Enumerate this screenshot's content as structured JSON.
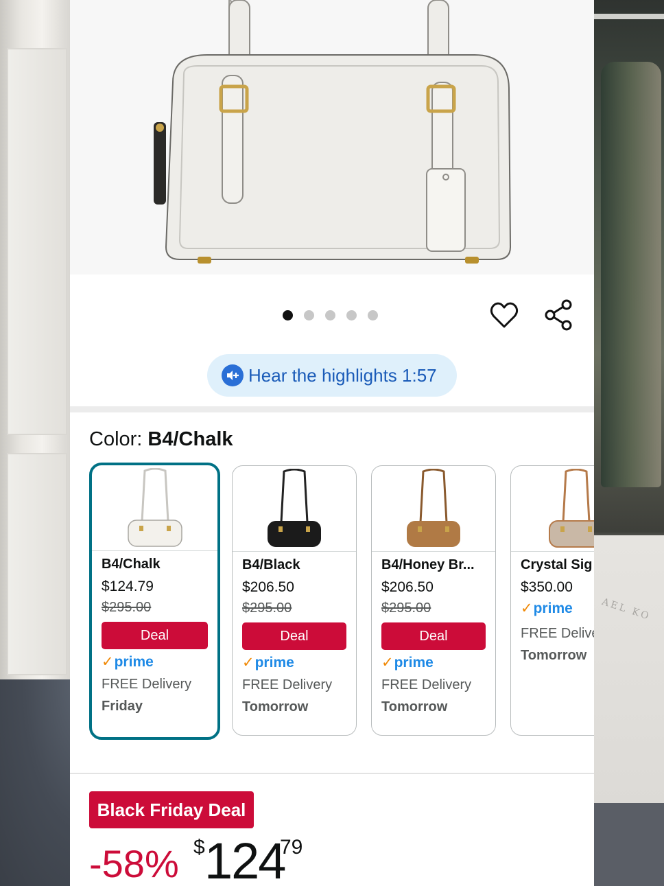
{
  "product": {
    "carousel": {
      "total_images": 5,
      "active_index": 0
    },
    "highlights_button_label": "Hear the highlights 1:57"
  },
  "color": {
    "label": "Color:",
    "selected": "B4/Chalk"
  },
  "swatches": [
    {
      "name": "B4/Chalk",
      "price": "$124.79",
      "list_price": "$295.00",
      "deal_label": "Deal",
      "prime_label": "prime",
      "delivery_label": "FREE Delivery",
      "delivery_day": "Friday",
      "bag_color": "#f3f1ec",
      "selected": true
    },
    {
      "name": "B4/Black",
      "price": "$206.50",
      "list_price": "$295.00",
      "deal_label": "Deal",
      "prime_label": "prime",
      "delivery_label": "FREE Delivery",
      "delivery_day": "Tomorrow",
      "bag_color": "#1b1b1b",
      "selected": false
    },
    {
      "name": "B4/Honey Br...",
      "price": "$206.50",
      "list_price": "$295.00",
      "deal_label": "Deal",
      "prime_label": "prime",
      "delivery_label": "FREE Delivery",
      "delivery_day": "Tomorrow",
      "bag_color": "#b07a45",
      "selected": false
    },
    {
      "name": "Crystal Sig",
      "price": "$350.00",
      "list_price": "",
      "deal_label": "",
      "prime_label": "prime",
      "delivery_label": "FREE Delive",
      "delivery_day": "Tomorrow",
      "bag_color": "#c9b8a6",
      "selected": false
    }
  ],
  "deal": {
    "badge": "Black Friday Deal",
    "discount": "-58%",
    "currency": "$",
    "price_whole": "124",
    "price_fraction": "79"
  },
  "colors": {
    "deal_red": "#cc0c39",
    "selected_teal": "#007185",
    "prime_blue": "#1f8ae6",
    "prime_check": "#f08804",
    "highlight_bg": "#dff0fb",
    "highlight_text": "#1a5bb8"
  },
  "background": {
    "shirt_print": "AEL KO"
  }
}
